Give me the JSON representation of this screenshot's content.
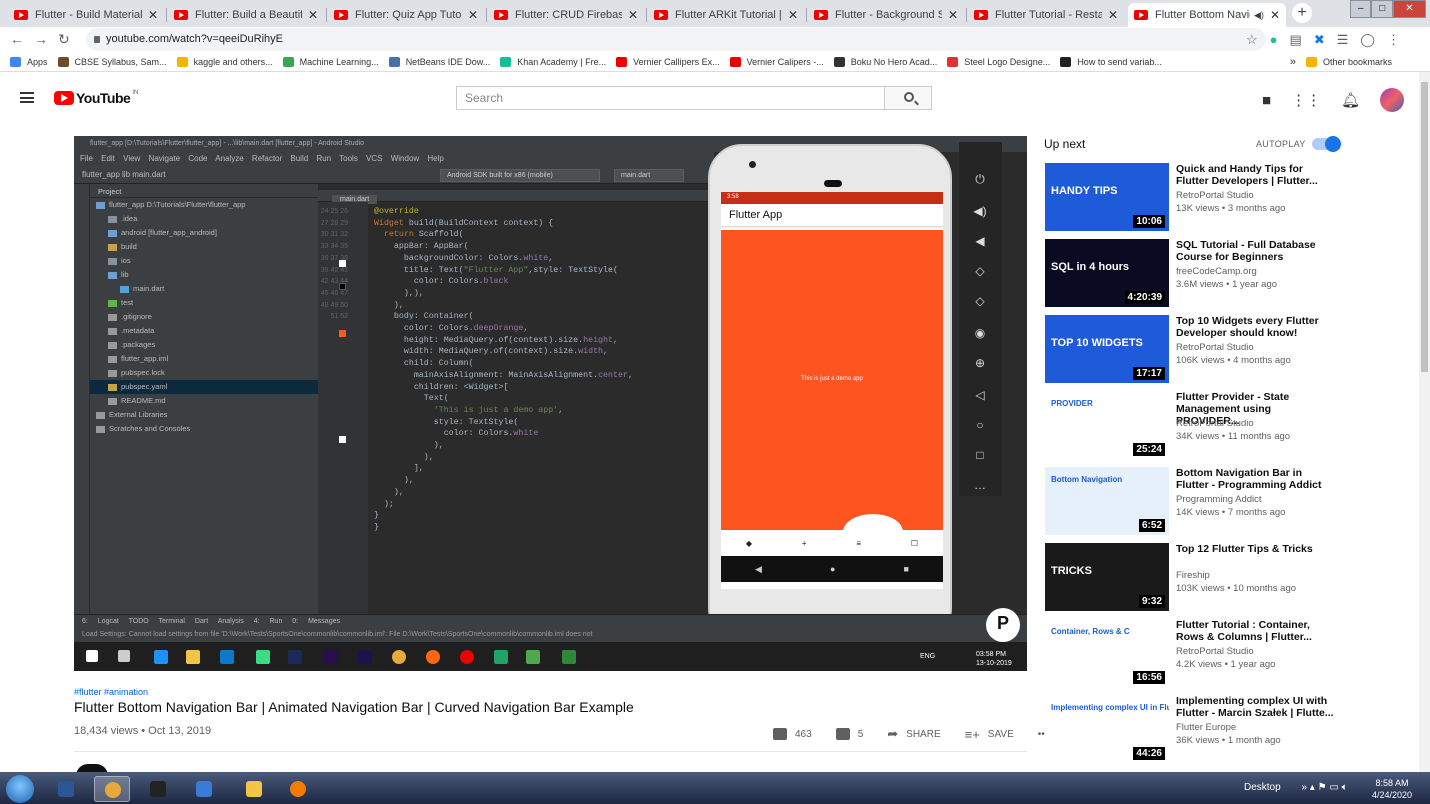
{
  "browser": {
    "tabs": [
      {
        "title": "Flutter - Build Material Chat"
      },
      {
        "title": "Flutter: Build a Beautiful Po"
      },
      {
        "title": "Flutter: Quiz App Tutorial | P"
      },
      {
        "title": "Flutter: CRUD Firebase Clou"
      },
      {
        "title": "Flutter ARKit Tutorial | iOS -"
      },
      {
        "title": "Flutter - Background Service"
      },
      {
        "title": "Flutter Tutorial - Restaurant"
      },
      {
        "title": "Flutter Bottom Navigati"
      }
    ],
    "url": "youtube.com/watch?v=qeeiDuRihyE",
    "bookmarks": [
      {
        "label": "Apps",
        "color": "#4285f4"
      },
      {
        "label": "CBSE Syllabus, Sam...",
        "color": "#6d4c2c"
      },
      {
        "label": "kaggle and others...",
        "color": "#f4b400"
      },
      {
        "label": "Machine Learning...",
        "color": "#34a853"
      },
      {
        "label": "NetBeans IDE Dow...",
        "color": "#4a6fa5"
      },
      {
        "label": "Khan Academy | Fre...",
        "color": "#14bf96"
      },
      {
        "label": "Vernier Callipers Ex...",
        "color": "#e00"
      },
      {
        "label": "Vernier Calipers -...",
        "color": "#e00"
      },
      {
        "label": "Boku No Hero Acad...",
        "color": "#333"
      },
      {
        "label": "Steel Logo Designe...",
        "color": "#d33"
      },
      {
        "label": "How to send variab...",
        "color": "#222"
      }
    ],
    "other_bookmarks": "Other bookmarks"
  },
  "youtube": {
    "logo": "YouTube",
    "region": "IN",
    "search_placeholder": "Search"
  },
  "player": {
    "ide_title": "flutter_app [D:\\Tutorials\\Flutter\\flutter_app] - ...\\lib\\main.dart [flutter_app] - Android Studio",
    "menu": "File Edit View Navigate Code Analyze Refactor Build Run Tools VCS Window Help",
    "breadcrumb": "flutter_app  lib  main.dart",
    "run_config": "Android SDK built for x86 (mobile)",
    "main_config": "main.dart",
    "project_header": "Project",
    "editor_tab": "main.dart",
    "project_tree": [
      {
        "label": "flutter_app  D:\\Tutorials\\Flutter\\flutter_app",
        "indent": 0,
        "color": "#6e9fd2"
      },
      {
        "label": ".idea",
        "indent": 1,
        "color": "#87939a"
      },
      {
        "label": "android [flutter_app_android]",
        "indent": 1,
        "color": "#6e9fd2"
      },
      {
        "label": "build",
        "indent": 1,
        "color": "#c9a14a"
      },
      {
        "label": "ios",
        "indent": 1,
        "color": "#87939a"
      },
      {
        "label": "lib",
        "indent": 1,
        "color": "#6e9fd2"
      },
      {
        "label": "main.dart",
        "indent": 2,
        "color": "#53a4d6"
      },
      {
        "label": "test",
        "indent": 1,
        "color": "#62b543"
      },
      {
        "label": ".gitignore",
        "indent": 1,
        "color": "#999"
      },
      {
        "label": ".metadata",
        "indent": 1,
        "color": "#999"
      },
      {
        "label": ".packages",
        "indent": 1,
        "color": "#999"
      },
      {
        "label": "flutter_app.iml",
        "indent": 1,
        "color": "#999"
      },
      {
        "label": "pubspec.lock",
        "indent": 1,
        "color": "#999"
      },
      {
        "label": "pubspec.yaml",
        "indent": 1,
        "color": "#c9a14a"
      },
      {
        "label": "README.md",
        "indent": 1,
        "color": "#999"
      },
      {
        "label": "External Libraries",
        "indent": 0,
        "color": "#999"
      },
      {
        "label": "Scratches and Consoles",
        "indent": 0,
        "color": "#999"
      }
    ],
    "line_numbers": "24\n25\n26\n27\n28\n29\n30\n31\n32\n33\n34\n35\n36\n37\n38\n39\n40\n41\n42\n43\n44\n45\n46\n47\n48\n49\n50\n51\n52",
    "bottom_tools": "6: Logcat  TODO  Terminal  Dart Analysis  4: Run  0: Messages",
    "status_text": "Load Settings: Cannot load settings from file 'D:\\Work\\Tests\\SportsOne\\commonlib\\commonlib.iml': File D:\\Work\\Tests\\SportsOne\\commonlib\\commonlib.iml does not",
    "inner_clock_time": "03:58 PM",
    "inner_clock_date": "13-10-2019",
    "inner_lang": "ENG",
    "emulator": {
      "status_time": "3:58",
      "app_title": "Flutter App",
      "body_text": "This is just a demo app",
      "nav_icons": [
        "◆",
        "+",
        "≡",
        "☐"
      ],
      "sys_nav": [
        "◀",
        "●",
        "■"
      ]
    }
  },
  "video": {
    "hashtags": "#flutter #animation",
    "title": "Flutter Bottom Navigation Bar | Animated Navigation Bar | Curved Navigation Bar Example",
    "views_date": "18,434 views • Oct 13, 2019",
    "likes": "463",
    "dislikes": "5",
    "share": "SHARE",
    "save": "SAVE",
    "more": "•••"
  },
  "sidebar": {
    "up_next": "Up next",
    "autoplay": "AUTOPLAY",
    "items": [
      {
        "title": "Quick and Handy Tips for Flutter Developers | Flutter...",
        "channel": "RetroPortal Studio",
        "meta": "13K views • 3 months ago",
        "duration": "10:06",
        "thumb_text": "HANDY TIPS",
        "thumb_bg": "#1e5bd8"
      },
      {
        "title": "SQL Tutorial - Full Database Course for Beginners",
        "channel": "freeCodeCamp.org",
        "meta": "3.6M views • 1 year ago",
        "duration": "4:20:39",
        "thumb_text": "SQL in 4 hours",
        "thumb_bg": "#0a0a23"
      },
      {
        "title": "Top 10 Widgets every Flutter Developer should know!",
        "channel": "RetroPortal Studio",
        "meta": "106K views • 4 months ago",
        "duration": "17:17",
        "thumb_text": "TOP 10 WIDGETS",
        "thumb_bg": "#1e5bd8"
      },
      {
        "title": "Flutter Provider - State Management using PROVIDER...",
        "channel": "RetroPortal Studio",
        "meta": "34K views • 11 months ago",
        "duration": "25:24",
        "thumb_text": "PROVIDER",
        "thumb_bg": "#ffffff"
      },
      {
        "title": "Bottom Navigation Bar in Flutter - Programming Addict",
        "channel": "Programming Addict",
        "meta": "14K views • 7 months ago",
        "duration": "6:52",
        "thumb_text": "Bottom Navigation",
        "thumb_bg": "#e6f0fa"
      },
      {
        "title": "Top 12 Flutter Tips & Tricks",
        "channel": "Fireship",
        "meta": "103K views • 10 months ago",
        "duration": "9:32",
        "thumb_text": "TRICKS",
        "thumb_bg": "#1a1a1a"
      },
      {
        "title": "Flutter Tutorial : Container, Rows & Columns | Flutter...",
        "channel": "RetroPortal Studio",
        "meta": "4.2K views • 1 year ago",
        "duration": "16:56",
        "thumb_text": "Container, Rows & C",
        "thumb_bg": "#ffffff"
      },
      {
        "title": "Implementing complex UI with Flutter - Marcin Szałek | Flutte...",
        "channel": "Flutter Europe",
        "meta": "36K views • 1 month ago",
        "duration": "44:26",
        "thumb_text": "Implementing complex UI in Flutter",
        "thumb_bg": "#ffffff"
      }
    ]
  },
  "taskbar": {
    "desktop_label": "Desktop",
    "time": "8:58 AM",
    "date": "4/24/2020"
  }
}
